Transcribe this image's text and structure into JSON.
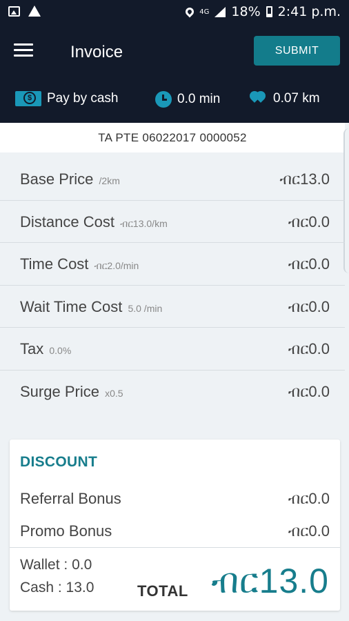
{
  "status_bar": {
    "battery": "18%",
    "network": "4G",
    "time": "2:41 p.m."
  },
  "app_bar": {
    "title": "Invoice",
    "submit_label": "SUBMIT",
    "payment_method": "Pay by cash",
    "duration": "0.0 min",
    "distance": "0.07 km"
  },
  "invoice_ref": "TA PTE 06022017 0000052",
  "costs": [
    {
      "label": "Base Price",
      "sub": "/2km",
      "value": "ብር13.0"
    },
    {
      "label": "Distance Cost",
      "sub": "ብር13.0/km",
      "value": "ብር0.0"
    },
    {
      "label": "Time Cost",
      "sub": "ብር2.0/min",
      "value": "ብር0.0"
    },
    {
      "label": "Wait Time Cost",
      "sub": "5.0 /min",
      "value": "ብር0.0"
    },
    {
      "label": "Tax",
      "sub": "0.0%",
      "value": "ብር0.0"
    },
    {
      "label": "Surge Price",
      "sub": "x0.5",
      "value": "ብር0.0"
    }
  ],
  "discount": {
    "title": "DISCOUNT",
    "referral_label": "Referral Bonus",
    "referral_value": "ብር0.0",
    "promo_label": "Promo Bonus",
    "promo_value": "ብር0.0"
  },
  "summary": {
    "wallet": "Wallet : 0.0",
    "cash": "Cash : 13.0",
    "total_label": "TOTAL",
    "total_value": "ብር13.0"
  },
  "colors": {
    "header_bg": "#121a2a",
    "accent": "#137c8b",
    "icon_blue": "#1a98b8"
  }
}
